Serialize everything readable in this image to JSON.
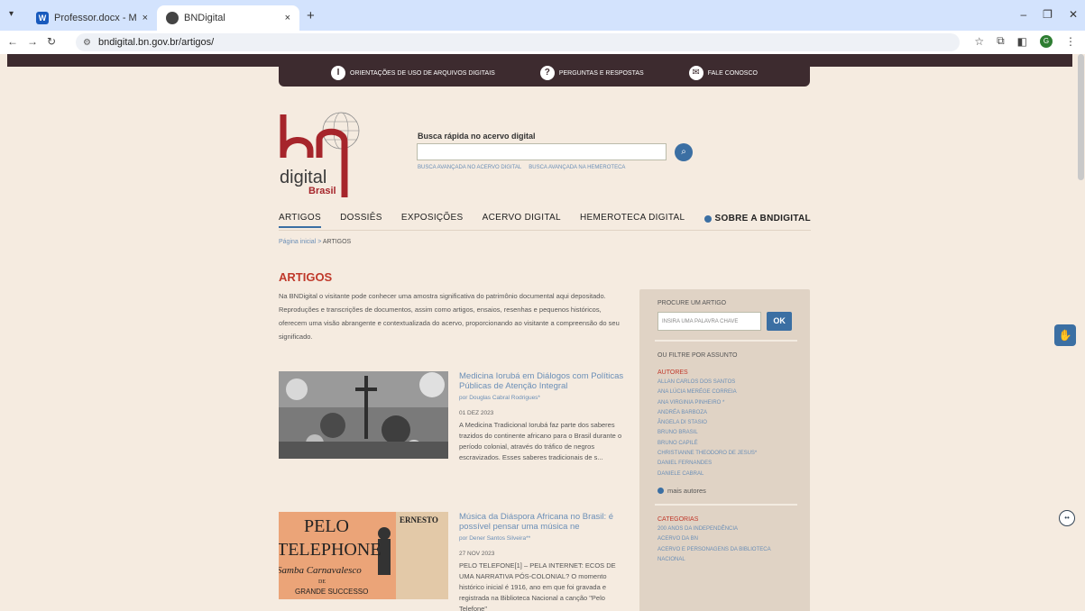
{
  "browser": {
    "tabs": [
      {
        "label": "Professor.docx - Microsoft Wor",
        "favicon": "word-icon",
        "favicon_text": "W"
      },
      {
        "label": "BNDigital",
        "favicon": "globe-icon"
      }
    ],
    "tab_close": "×",
    "new_tab": "+",
    "url": "bndigital.bn.gov.br/artigos/",
    "profile_initial": "G"
  },
  "utility": {
    "items": [
      {
        "label": "ORIENTAÇÕES DE USO DE ARQUIVOS DIGITAIS",
        "icon": "info-icon"
      },
      {
        "label": "PERGUNTAS E RESPOSTAS",
        "icon": "question-icon"
      },
      {
        "label": "FALE CONOSCO",
        "icon": "mail-icon"
      }
    ]
  },
  "logo": {
    "text1": "digital",
    "text2": "Brasil"
  },
  "search": {
    "label": "Busca rápida no acervo digital",
    "adv1": "BUSCA AVANÇADA NO ACERVO DIGITAL",
    "adv2": "BUSCA AVANÇADA NA HEMEROTECA"
  },
  "nav": {
    "items": [
      "ARTIGOS",
      "DOSSIÊS",
      "EXPOSIÇÕES",
      "ACERVO DIGITAL",
      "HEMEROTECA DIGITAL"
    ],
    "sobre": "SOBRE A BNDIGITAL"
  },
  "breadcrumb": {
    "home": "Página inicial",
    "sep": " > ",
    "current": "ARTIGOS"
  },
  "page": {
    "title": "ARTIGOS",
    "intro": "Na BNDigital o visitante pode conhecer uma amostra significativa do patrimônio documental aqui depositado. Reproduções e transcrições de documentos, assim como artigos, ensaios, resenhas e pequenos históricos, oferecem uma visão abrangente e contextualizada do acervo, proporcionando ao visitante a compreensão do seu significado."
  },
  "articles": [
    {
      "title": "Medicina Iorubá em Diálogos com Políticas Públicas de Atenção Integral",
      "author": "por Douglas Cabral Rodrigues*",
      "date": "01 DEZ 2023",
      "excerpt": "A Medicina Tradicional Iorubá faz parte dos saberes trazidos do continente africano para o Brasil durante o período colonial, através do tráfico de negros escravizados. Esses saberes tradicionais de s..."
    },
    {
      "title": "Música da Diáspora Africana no Brasil: é possível pensar uma música ne",
      "author": "por Dener Santos Silveira**",
      "date": "27 NOV 2023",
      "excerpt": "PELO TELEFONE[1] – PELA INTERNET: ECOS DE UMA NARRATIVA PÓS-COLONIAL? O momento histórico inicial é 1916, ano em que foi gravada e registrada na Biblioteca Nacional a canção \"Pelo Telefone\"",
      "thumb_text": {
        "l1": "PELO",
        "l2": "TELEPHONE",
        "l3": "Samba Carnavalesco",
        "l4": "DE",
        "l5": "GRANDE SUCCESSO",
        "r1": "ERNESTO"
      }
    }
  ],
  "sidebar": {
    "search_heading": "PROCURE UM ARTIGO",
    "search_placeholder": "INSIRA UMA PALAVRA CHAVE",
    "ok": "OK",
    "filter_heading": "OU FILTRE POR ASSUNTO",
    "authors_heading": "AUTORES",
    "authors": [
      "ALLAN CARLOS DOS SANTOS",
      "ANA LÚCIA MERÉGE CORREIA",
      "ANA VIRGINIA PINHEIRO *",
      "ANDRÉA BARBOZA",
      "ÂNGELA DI STASIO",
      "BRUNO BRASIL",
      "BRUNO CAPILÉ",
      "CHRISTIANNE THEODORO DE JESUS*",
      "DANIEL FERNANDES",
      "DANIELE CABRAL"
    ],
    "more_authors": "mais autores",
    "categories_heading": "CATEGORIAS",
    "categories": [
      "200 ANOS DA INDEPENDÊNCIA",
      "ACERVO DA BN",
      "ACERVO E PERSONAGENS DA BIBLIOTECA",
      "NACIONAL"
    ]
  },
  "colors": {
    "accent": "#3b6fa3",
    "title_red": "#c0392b",
    "link": "#6b8fb7",
    "dark_bar": "#3d2b2f",
    "bg": "#f5ebe0"
  }
}
